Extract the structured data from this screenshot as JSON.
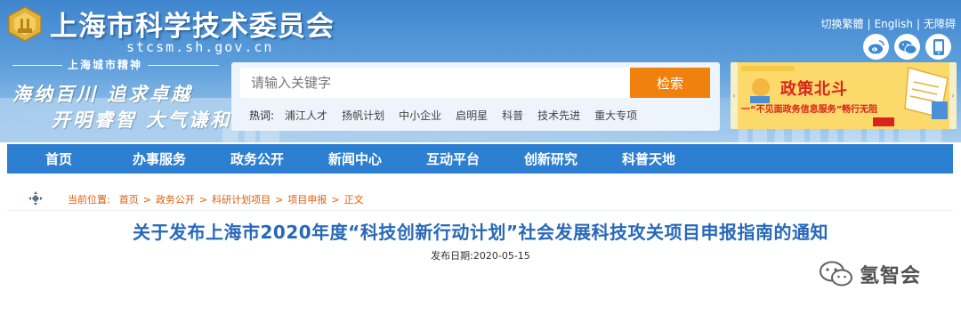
{
  "header": {
    "site_title": "上海市科学技术委员会",
    "site_domain": "stcsm.sh.gov.cn",
    "spirit_title": "上海城市精神",
    "spirit_line1": "海纳百川 追求卓越",
    "spirit_line2": "开明睿智 大气谦和",
    "top_links": [
      "切换繁體",
      "English",
      "无障碍"
    ],
    "social_icons": [
      "weibo-icon",
      "wechat-icon",
      "mobile-icon"
    ]
  },
  "search": {
    "placeholder": "请输入关键字",
    "button_label": "检索",
    "hot_label": "热词:",
    "hot_words": [
      "浦江人才",
      "扬帆计划",
      "中小企业",
      "启明星",
      "科普",
      "技术先进",
      "重大专项"
    ]
  },
  "banner": {
    "title": "政策北斗",
    "subtitle": "一“不见面政务信息服务”畅行无阻"
  },
  "nav": {
    "items": [
      "首页",
      "办事服务",
      "政务公开",
      "新闻中心",
      "互动平台",
      "创新研究",
      "科普天地"
    ]
  },
  "breadcrumb": {
    "label": "当前位置:",
    "items": [
      "首页",
      "政务公开",
      "科研计划项目",
      "项目申报",
      "正文"
    ],
    "separator": ">"
  },
  "article": {
    "title": "关于发布上海市2020年度“科技创新行动计划”社会发展科技攻关项目申报指南的通知",
    "publish_date": "发布日期:2020-05-15"
  },
  "watermark": {
    "text": "氢智会"
  },
  "colors": {
    "nav_bg": "#2d7fd1",
    "search_button": "#f0810c",
    "title_blue": "#2868b9",
    "crumb_orange": "#e15d0b",
    "banner_red": "#d9231c"
  }
}
